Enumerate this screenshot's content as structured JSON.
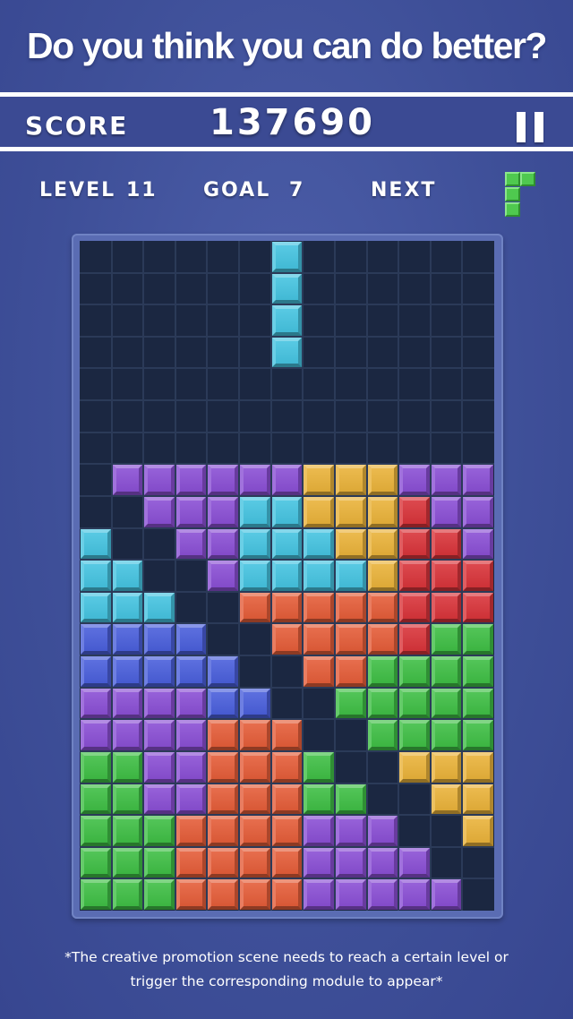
{
  "headline": "Do you think you can do better?",
  "score": {
    "label": "SCORE",
    "value": "137690"
  },
  "info": {
    "level_label": "LEVEL",
    "level_value": "11",
    "goal_label": "GOAL",
    "goal_value": "7",
    "next_label": "NEXT",
    "next_piece": "green-J-piece"
  },
  "colors": {
    "purple": "#8a4fd4",
    "yellow": "#e9b23a",
    "red": "#d8343a",
    "cyan": "#45c3e0",
    "orange": "#e45d39",
    "blue": "#4a5fdb",
    "green": "#3fbe45",
    "board_background": "#1b2741",
    "page_background": "#3e4f98"
  },
  "board": {
    "columns": 13,
    "rows": 21,
    "falling_piece": {
      "color": "cyan",
      "cells": [
        [
          0,
          6
        ],
        [
          1,
          6
        ],
        [
          2,
          6
        ],
        [
          3,
          6
        ]
      ]
    },
    "stack": [
      "...............",
      "...............",
      "...............",
      "...............",
      "...............",
      "...............",
      "...............",
      ".PPPPPPYYYPPP",
      "..PPPCCYYYRPP",
      "C..PPCCCYYRRP",
      "CC..PCCCCYRRR",
      "CCC..OOOOORRR",
      "BBBB..OOOORGG",
      "BBBBB..OOGGGG",
      "PPPPBB..GGGGG",
      "PPPPOOO..GGGG",
      "GGPPOOOG..YYY",
      "GGPPOOOGG..YY",
      "GGGOOOOPPP..Y",
      "GGGOOOOPPPP..",
      "GGGOOOOPPPPP."
    ]
  },
  "footnote": {
    "line1": "*The creative promotion scene needs to reach a certain level or",
    "line2": "trigger the corresponding module to appear*"
  }
}
